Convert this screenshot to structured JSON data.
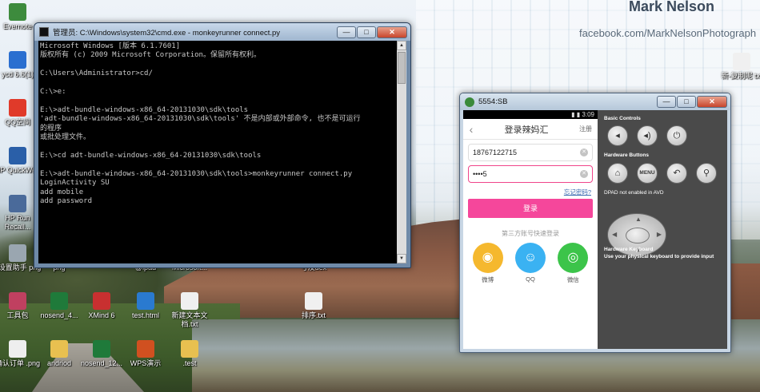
{
  "desktop": {
    "watermark_name": "Mark Nelson",
    "watermark_url": "facebook.com/MarkNelsonPhotograph",
    "icons": [
      {
        "label": "Evernote",
        "icon": "evernote-icon",
        "color": "#3d8b3d"
      },
      {
        "label": "ycd 6.6(1)",
        "icon": "paw-icon",
        "color": "#2a6fd0"
      },
      {
        "label": "QQ空间",
        "icon": "penguin-icon",
        "color": "#e03a2a"
      },
      {
        "label": "HP QuickWeb",
        "icon": "hp-icon",
        "color": "#2a5fa8"
      },
      {
        "label": "HP Run Recall...",
        "icon": "app-icon",
        "color": "#4a6a9a"
      },
      {
        "label": "b设置助手 png",
        "icon": "image-file-icon",
        "color": "#9aa6b0"
      },
      {
        "label": "工具包",
        "icon": "tool-icon",
        "color": "#c04060"
      },
      {
        "label": "确认订单 .png",
        "icon": "image-file-icon",
        "color": "#eeeeee"
      },
      {
        "label": "png",
        "icon": "image-file-icon",
        "color": "#8a9aa8"
      },
      {
        "label": "nosend_4...",
        "icon": "excel-icon",
        "color": "#1f7a3a"
      },
      {
        "label": "andriod",
        "icon": "folder-icon",
        "color": "#e8c050"
      },
      {
        "label": "XMind 6",
        "icon": "xmind-icon",
        "color": "#c83030"
      },
      {
        "label": "nosend_12...",
        "icon": "excel-icon",
        "color": "#1f7a3a"
      },
      {
        "label": "test.html",
        "icon": "browser-icon",
        "color": "#2a7ad0"
      },
      {
        "label": "WPS演示",
        "icon": "wps-icon",
        "color": "#d05020"
      },
      {
        "label": "新建文本文档.txt",
        "icon": "text-file-icon",
        "color": "#f0f0f0"
      },
      {
        "label": ".test",
        "icon": "folder-icon",
        "color": "#e8c050"
      },
      {
        "label": "排序.txt",
        "icon": "text-file-icon",
        "color": "#f0f0f0"
      },
      {
        "label": "Microsoft...",
        "icon": "word-icon",
        "color": "#2a5aa8"
      },
      {
        "label": "@ipad",
        "icon": "image-file-icon",
        "color": "#8a9aa8"
      },
      {
        "label": "号及dex",
        "icon": "file-icon",
        "color": "#9aa6b0"
      },
      {
        "label": "新-复制呢 txt",
        "icon": "text-file-icon",
        "color": "#f0f0f0"
      }
    ]
  },
  "cmd": {
    "title": "管理员: C:\\Windows\\system32\\cmd.exe - monkeyrunner  connect.py",
    "lines": [
      "Microsoft Windows [版本 6.1.7601]",
      "版权所有 (c) 2009 Microsoft Corporation。保留所有权利。",
      "",
      "C:\\Users\\Administrator>cd/",
      "",
      "C:\\>e:",
      "",
      "E:\\>adt-bundle-windows-x86_64-20131030\\sdk\\tools",
      "'adt-bundle-windows-x86_64-20131030\\sdk\\tools' 不是内部或外部命令, 也不是可运行",
      "的程序",
      "或批处理文件。",
      "",
      "E:\\>cd adt-bundle-windows-x86_64-20131030\\sdk\\tools",
      "",
      "E:\\>adt-bundle-windows-x86_64-20131030\\sdk\\tools>monkeyrunner connect.py",
      "LoginActivity SU",
      "add mobile",
      "add password"
    ]
  },
  "emulator": {
    "title": "5554:SB",
    "phone": {
      "time": "3:09",
      "header_title": "登录辣妈汇",
      "register": "注册",
      "mobile_value": "18767122715",
      "password_value": "••••5",
      "forgot": "忘记密码?",
      "login": "登录",
      "third_party": "第三方账号快速登录",
      "socials": [
        {
          "label": "微博",
          "icon": "weibo-icon",
          "color": "#f5b82e"
        },
        {
          "label": "QQ",
          "icon": "qq-icon",
          "color": "#3ab2f2"
        },
        {
          "label": "微信",
          "icon": "wechat-icon",
          "color": "#3cc44a"
        }
      ]
    },
    "controls": {
      "basic": "Basic Controls",
      "hardware": "Hardware Buttons",
      "menu": "MENU",
      "dpad": "DPAD not enabled in AVD",
      "keyboard_title": "Hardware Keyboard",
      "keyboard_desc": "Use your physical keyboard to provide input"
    }
  }
}
